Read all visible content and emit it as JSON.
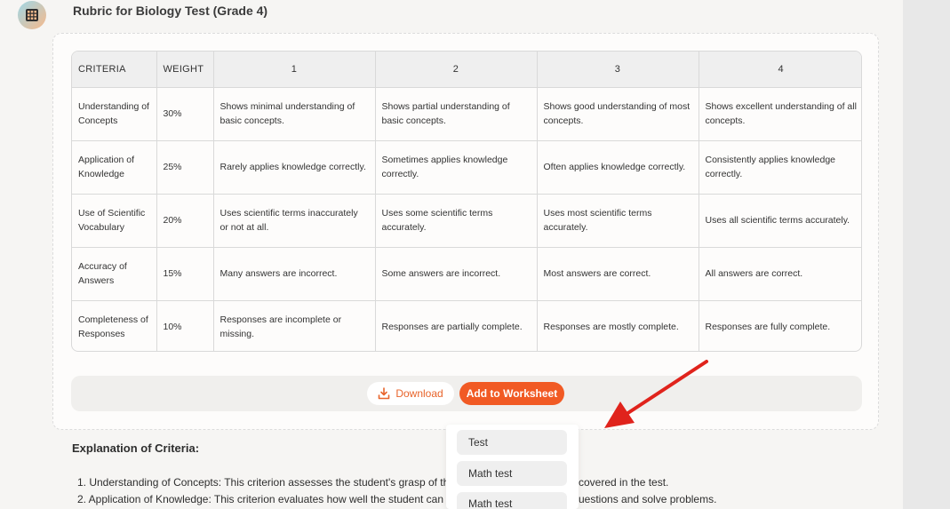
{
  "header": {
    "title": "Rubric for Biology Test (Grade 4)",
    "avatar_icon": "grid-icon"
  },
  "rubric": {
    "columns": [
      "CRITERIA",
      "WEIGHT",
      "1",
      "2",
      "3",
      "4"
    ],
    "rows": [
      {
        "criteria": "Understanding of Concepts",
        "weight": "30%",
        "levels": [
          "Shows minimal understanding of basic concepts.",
          "Shows partial understanding of basic concepts.",
          "Shows good understanding of most concepts.",
          "Shows excellent understanding of all concepts."
        ]
      },
      {
        "criteria": "Application of Knowledge",
        "weight": "25%",
        "levels": [
          "Rarely applies knowledge correctly.",
          "Sometimes applies knowledge correctly.",
          "Often applies knowledge correctly.",
          "Consistently applies knowledge correctly."
        ]
      },
      {
        "criteria": "Use of Scientific Vocabulary",
        "weight": "20%",
        "levels": [
          "Uses scientific terms inaccurately or not at all.",
          "Uses some scientific terms accurately.",
          "Uses most scientific terms accurately.",
          "Uses all scientific terms accurately."
        ]
      },
      {
        "criteria": "Accuracy of Answers",
        "weight": "15%",
        "levels": [
          "Many answers are incorrect.",
          "Some answers are incorrect.",
          "Most answers are correct.",
          "All answers are correct."
        ]
      },
      {
        "criteria": "Completeness of Responses",
        "weight": "10%",
        "levels": [
          "Responses are incomplete or missing.",
          "Responses are partially complete.",
          "Responses are mostly complete.",
          "Responses are fully complete."
        ]
      }
    ]
  },
  "actions": {
    "download_label": "Download",
    "add_label": "Add to Worksheet",
    "accent_color": "#f15a24"
  },
  "dropdown": {
    "items": [
      "Test",
      "Math test",
      "Math test"
    ]
  },
  "explanation": {
    "heading": "Explanation of Criteria:",
    "line1_start": "1. Understanding of Concepts: This criterion assesses the student's grasp of the fun",
    "line1_end": "covered in the test.",
    "line2_start": "2. Application of Knowledge: This criterion evaluates how well the student can appl",
    "line2_end": "uestions and solve problems."
  },
  "annotation": {
    "arrow_color": "#e0231c"
  }
}
